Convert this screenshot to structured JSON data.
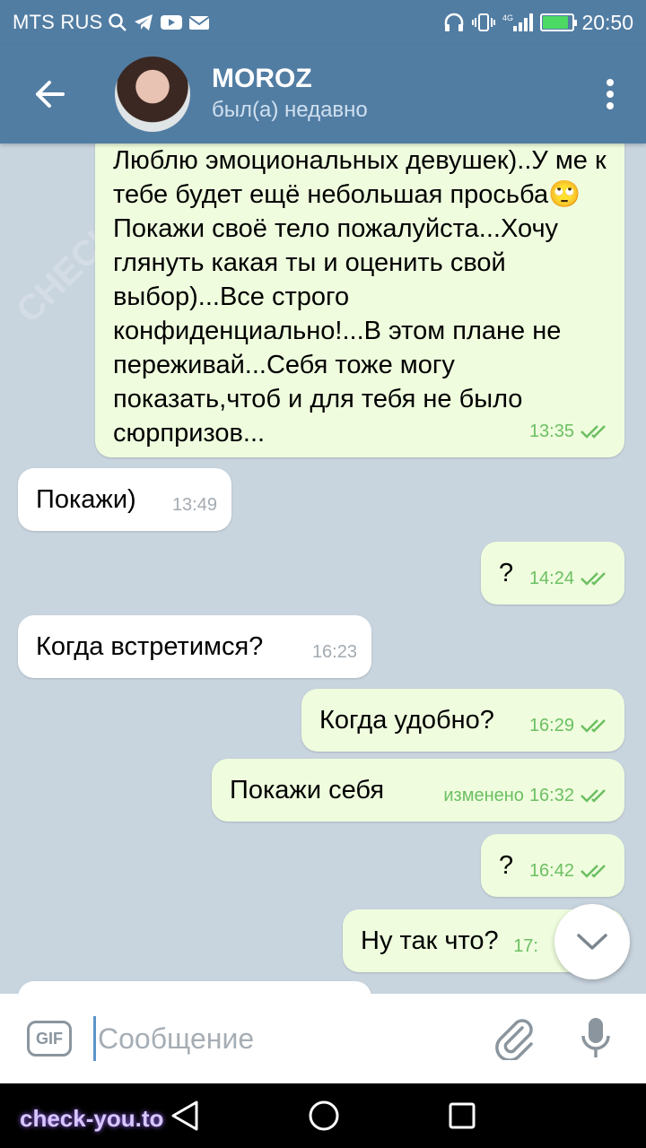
{
  "status_bar": {
    "carrier": "MTS RUS",
    "time": "20:50",
    "network": "4G",
    "battery_level": 0.85
  },
  "header": {
    "contact_name": "MOROZ",
    "contact_status": "был(а) недавно"
  },
  "messages": [
    {
      "direction": "out",
      "text": "Люблю эмоциональных девушек)..У ме к тебе будет ещё небольшая просьба🙄Покажи своё тело пожалуйста...Хочу глянуть какая ты и оценить свой выбор)...Все строго конфиденциально!...В этом плане не переживай...Себя тоже могу показать,чтоб и для тебя не было сюрпризов...",
      "time": "13:35",
      "read": true
    },
    {
      "direction": "in",
      "text": "Покажи)",
      "time": "13:49"
    },
    {
      "direction": "out",
      "text": "?",
      "time": "14:24",
      "read": true
    },
    {
      "direction": "in",
      "text": "Когда встретимся?",
      "time": "16:23"
    },
    {
      "direction": "out",
      "text": "Когда удобно?",
      "time": "16:29",
      "read": true
    },
    {
      "direction": "out",
      "text": "Покажи себя",
      "edited_label": "изменено",
      "time": "16:32",
      "read": true
    },
    {
      "direction": "out",
      "text": "?",
      "time": "16:42",
      "read": true
    },
    {
      "direction": "out",
      "text": "Ну так что?",
      "time": "17:",
      "read": true
    }
  ],
  "input": {
    "gif_label": "GIF",
    "placeholder": "Сообщение"
  },
  "watermark": {
    "bottom": "check-you.to",
    "background": "CHECK-YOU.ME"
  },
  "colors": {
    "header": "#527da3",
    "outgoing_bubble": "#effdde",
    "incoming_bubble": "#ffffff",
    "check_marks": "#6cbf62",
    "chat_background": "#c8d4de"
  }
}
